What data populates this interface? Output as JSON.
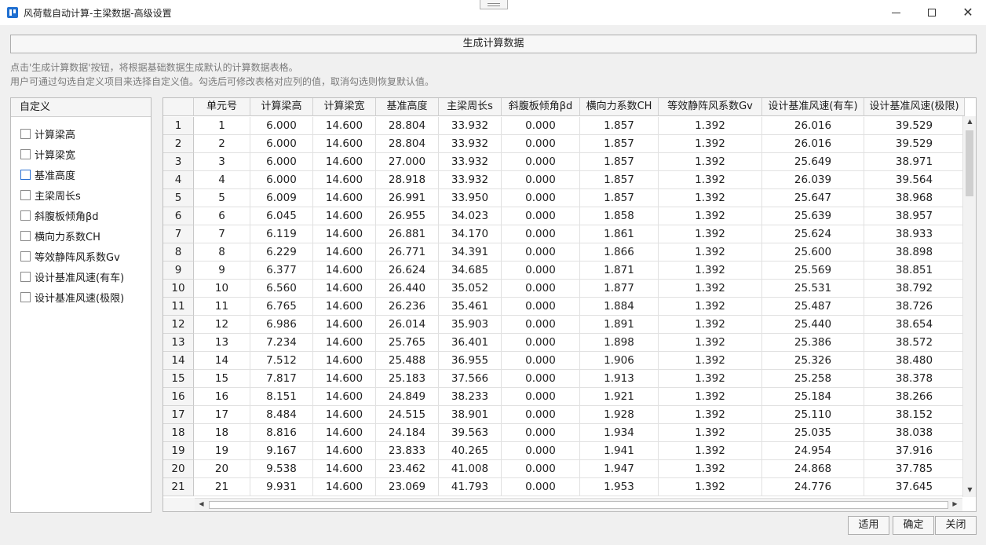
{
  "window": {
    "title": "风荷载自动计算-主梁数据-高级设置",
    "minimize": "—",
    "maximize": "☐",
    "close": "✕"
  },
  "generate_button": "生成计算数据",
  "hints": [
    "点击'生成计算数据'按钮，将根据基础数据生成默认的计算数据表格。",
    "用户可通过勾选自定义项目来选择自定义值。勾选后可修改表格对应列的值，取消勾选则恢复默认值。"
  ],
  "custom_panel": {
    "header": "自定义",
    "items": [
      {
        "label": "计算梁高",
        "checked": false
      },
      {
        "label": "计算梁宽",
        "checked": false
      },
      {
        "label": "基准高度",
        "checked": false
      },
      {
        "label": "主梁周长s",
        "checked": false
      },
      {
        "label": "斜腹板倾角βd",
        "checked": false
      },
      {
        "label": "横向力系数CH",
        "checked": false
      },
      {
        "label": "等效静阵风系数Gv",
        "checked": false
      },
      {
        "label": "设计基准风速(有车)",
        "checked": false
      },
      {
        "label": "设计基准风速(极限)",
        "checked": false
      }
    ]
  },
  "table": {
    "columns": [
      "单元号",
      "计算梁高",
      "计算梁宽",
      "基准高度",
      "主梁周长s",
      "斜腹板倾角βd",
      "横向力系数CH",
      "等效静阵风系数Gv",
      "设计基准风速(有车)",
      "设计基准风速(极限)"
    ],
    "row_headers": [
      "1",
      "2",
      "3",
      "4",
      "5",
      "6",
      "7",
      "8",
      "9",
      "10",
      "11",
      "12",
      "13",
      "14",
      "15",
      "16",
      "17",
      "18",
      "19",
      "20",
      "21"
    ],
    "rows": [
      [
        "1",
        "6.000",
        "14.600",
        "28.804",
        "33.932",
        "0.000",
        "1.857",
        "1.392",
        "26.016",
        "39.529"
      ],
      [
        "2",
        "6.000",
        "14.600",
        "28.804",
        "33.932",
        "0.000",
        "1.857",
        "1.392",
        "26.016",
        "39.529"
      ],
      [
        "3",
        "6.000",
        "14.600",
        "27.000",
        "33.932",
        "0.000",
        "1.857",
        "1.392",
        "25.649",
        "38.971"
      ],
      [
        "4",
        "6.000",
        "14.600",
        "28.918",
        "33.932",
        "0.000",
        "1.857",
        "1.392",
        "26.039",
        "39.564"
      ],
      [
        "5",
        "6.009",
        "14.600",
        "26.991",
        "33.950",
        "0.000",
        "1.857",
        "1.392",
        "25.647",
        "38.968"
      ],
      [
        "6",
        "6.045",
        "14.600",
        "26.955",
        "34.023",
        "0.000",
        "1.858",
        "1.392",
        "25.639",
        "38.957"
      ],
      [
        "7",
        "6.119",
        "14.600",
        "26.881",
        "34.170",
        "0.000",
        "1.861",
        "1.392",
        "25.624",
        "38.933"
      ],
      [
        "8",
        "6.229",
        "14.600",
        "26.771",
        "34.391",
        "0.000",
        "1.866",
        "1.392",
        "25.600",
        "38.898"
      ],
      [
        "9",
        "6.377",
        "14.600",
        "26.624",
        "34.685",
        "0.000",
        "1.871",
        "1.392",
        "25.569",
        "38.851"
      ],
      [
        "10",
        "6.560",
        "14.600",
        "26.440",
        "35.052",
        "0.000",
        "1.877",
        "1.392",
        "25.531",
        "38.792"
      ],
      [
        "11",
        "6.765",
        "14.600",
        "26.236",
        "35.461",
        "0.000",
        "1.884",
        "1.392",
        "25.487",
        "38.726"
      ],
      [
        "12",
        "6.986",
        "14.600",
        "26.014",
        "35.903",
        "0.000",
        "1.891",
        "1.392",
        "25.440",
        "38.654"
      ],
      [
        "13",
        "7.234",
        "14.600",
        "25.765",
        "36.401",
        "0.000",
        "1.898",
        "1.392",
        "25.386",
        "38.572"
      ],
      [
        "14",
        "7.512",
        "14.600",
        "25.488",
        "36.955",
        "0.000",
        "1.906",
        "1.392",
        "25.326",
        "38.480"
      ],
      [
        "15",
        "7.817",
        "14.600",
        "25.183",
        "37.566",
        "0.000",
        "1.913",
        "1.392",
        "25.258",
        "38.378"
      ],
      [
        "16",
        "8.151",
        "14.600",
        "24.849",
        "38.233",
        "0.000",
        "1.921",
        "1.392",
        "25.184",
        "38.266"
      ],
      [
        "17",
        "8.484",
        "14.600",
        "24.515",
        "38.901",
        "0.000",
        "1.928",
        "1.392",
        "25.110",
        "38.152"
      ],
      [
        "18",
        "8.816",
        "14.600",
        "24.184",
        "39.563",
        "0.000",
        "1.934",
        "1.392",
        "25.035",
        "38.038"
      ],
      [
        "19",
        "9.167",
        "14.600",
        "23.833",
        "40.265",
        "0.000",
        "1.941",
        "1.392",
        "24.954",
        "37.916"
      ],
      [
        "20",
        "9.538",
        "14.600",
        "23.462",
        "41.008",
        "0.000",
        "1.947",
        "1.392",
        "24.868",
        "37.785"
      ],
      [
        "21",
        "9.931",
        "14.600",
        "23.069",
        "41.793",
        "0.000",
        "1.953",
        "1.392",
        "24.776",
        "37.645"
      ]
    ]
  },
  "footer": {
    "apply": "适用",
    "ok": "确定",
    "close": "关闭"
  },
  "colors": {
    "accent": "#1f6fd1",
    "header_bg": "#f5f5f5"
  }
}
